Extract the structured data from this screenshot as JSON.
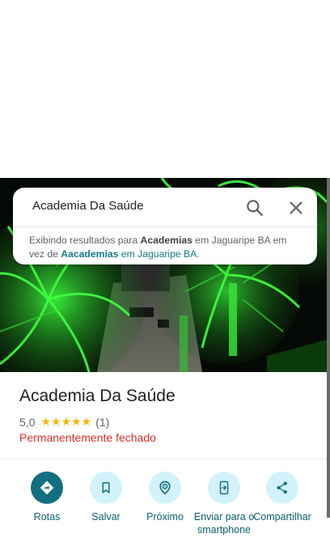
{
  "search": {
    "query": "Academia Da Saúde",
    "notice_prefix": "Exibindo resultados para ",
    "notice_bold": "Academias",
    "notice_mid": " em Jaguaripe BA em vez de ",
    "notice_link_bold": "Aacademias",
    "notice_link_rest": " em Jaguaripe BA",
    "notice_end": "."
  },
  "place": {
    "name": "Academia Da Saúde",
    "rating": "5,0",
    "stars": "★★★★★",
    "review_count": "(1)",
    "status": "Permanentemente fechado"
  },
  "actions": [
    {
      "label": "Rotas",
      "icon": "directions-icon"
    },
    {
      "label": "Salvar",
      "icon": "bookmark-icon"
    },
    {
      "label": "Próximo",
      "icon": "nearby-icon"
    },
    {
      "label": "Enviar para o smartphone",
      "icon": "send-to-phone-icon"
    },
    {
      "label": "Compartilhar",
      "icon": "share-icon"
    }
  ],
  "colors": {
    "accent": "#11707f",
    "status_closed": "#d93025",
    "star": "#f6b400"
  }
}
